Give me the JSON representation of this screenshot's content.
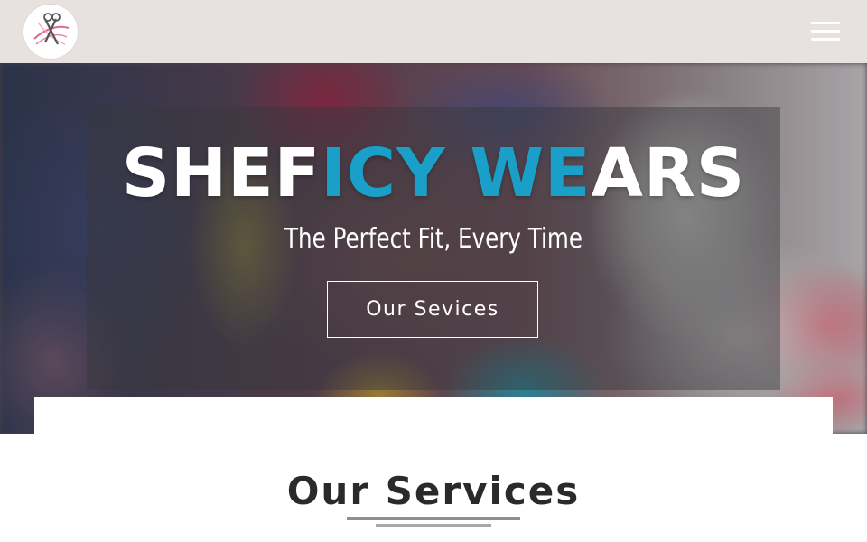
{
  "header": {
    "logo_icon": "scissors-thread-logo",
    "menu_icon": "hamburger-menu-icon"
  },
  "hero": {
    "title_part1": "SHEF",
    "title_accent1": "ICY",
    "title_accent2": "WE",
    "title_part2": "ARS",
    "tagline": "The Perfect Fit, Every Time",
    "cta_label": "Our Sevices"
  },
  "services": {
    "heading": "Our Services"
  },
  "colors": {
    "header_bg": "#e7e2df",
    "accent": "#1aa0c8",
    "heading_text": "#2a2a2a"
  }
}
